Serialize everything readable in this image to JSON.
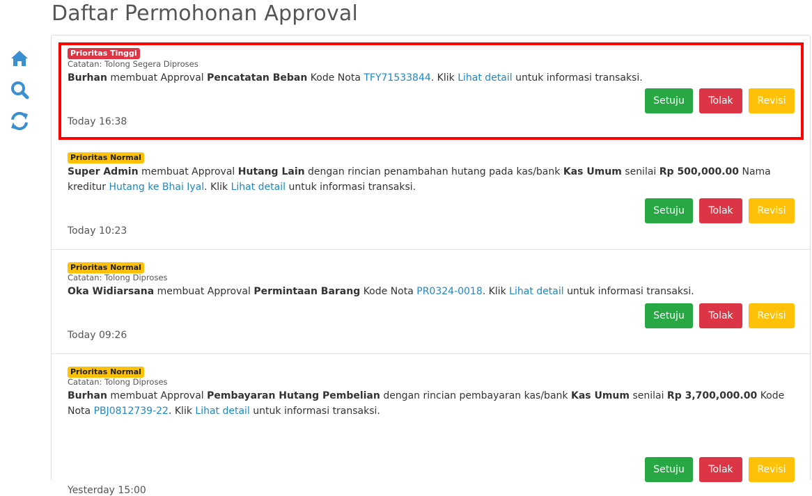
{
  "page": {
    "title": "Daftar Permohonan Approval"
  },
  "sidebar": {
    "icons": [
      "home-icon",
      "search-icon",
      "refresh-icon"
    ]
  },
  "colors": {
    "accent": "#3a8fd1",
    "success": "#28a745",
    "danger": "#dc3545",
    "warning": "#ffc107",
    "highlight_border": "#ff0000"
  },
  "buttons": {
    "approve": "Setuju",
    "reject": "Tolak",
    "revise": "Revisi"
  },
  "requests": [
    {
      "priority": "Prioritas Tinggi",
      "note": "Catatan: Tolong Segera Diproses",
      "user": "Burhan",
      "t1": "membuat Approval",
      "type": "Pencatatan Beban",
      "t2": "Kode Nota",
      "code": "TFY71533844",
      "t3": ". Klik",
      "detail_link": "Lihat detail",
      "t4": "untuk informasi transaksi.",
      "time": "Today 16:38"
    },
    {
      "priority": "Prioritas Normal",
      "user": "Super Admin",
      "t1": "membuat Approval",
      "type": "Hutang Lain",
      "t2": "dengan rincian penambahan hutang pada kas/bank",
      "account": "Kas Umum",
      "t3": "senilai",
      "amount": "Rp 500,000.00",
      "t4": "Nama kreditur",
      "creditor": "Hutang ke Bhai Iyal",
      "t5": ". Klik",
      "detail_link": "Lihat detail",
      "t6": "untuk informasi transaksi.",
      "time": "Today 10:23"
    },
    {
      "priority": "Prioritas Normal",
      "note": "Catatan: Tolong Diproses",
      "user": "Oka Widiarsana",
      "t1": "membuat Approval",
      "type": "Permintaan Barang",
      "t2": "Kode Nota",
      "code": "PR0324-0018",
      "t3": ". Klik",
      "detail_link": "Lihat detail",
      "t4": "untuk informasi transaksi.",
      "time": "Today 09:26"
    },
    {
      "priority": "Prioritas Normal",
      "note": "Catatan: Tolong Diproses",
      "user": "Burhan",
      "t1": "membuat Approval",
      "type": "Pembayaran Hutang Pembelian",
      "t2": "dengan rincian pembayaran kas/bank",
      "account": "Kas Umum",
      "t3": "senilai",
      "amount": "Rp 3,700,000.00",
      "t4": "Kode Nota",
      "code": "PBJ0812739-22",
      "t5": ". Klik",
      "detail_link": "Lihat detail",
      "t6": "untuk informasi transaksi.",
      "time": "Yesterday 15:00"
    }
  ]
}
